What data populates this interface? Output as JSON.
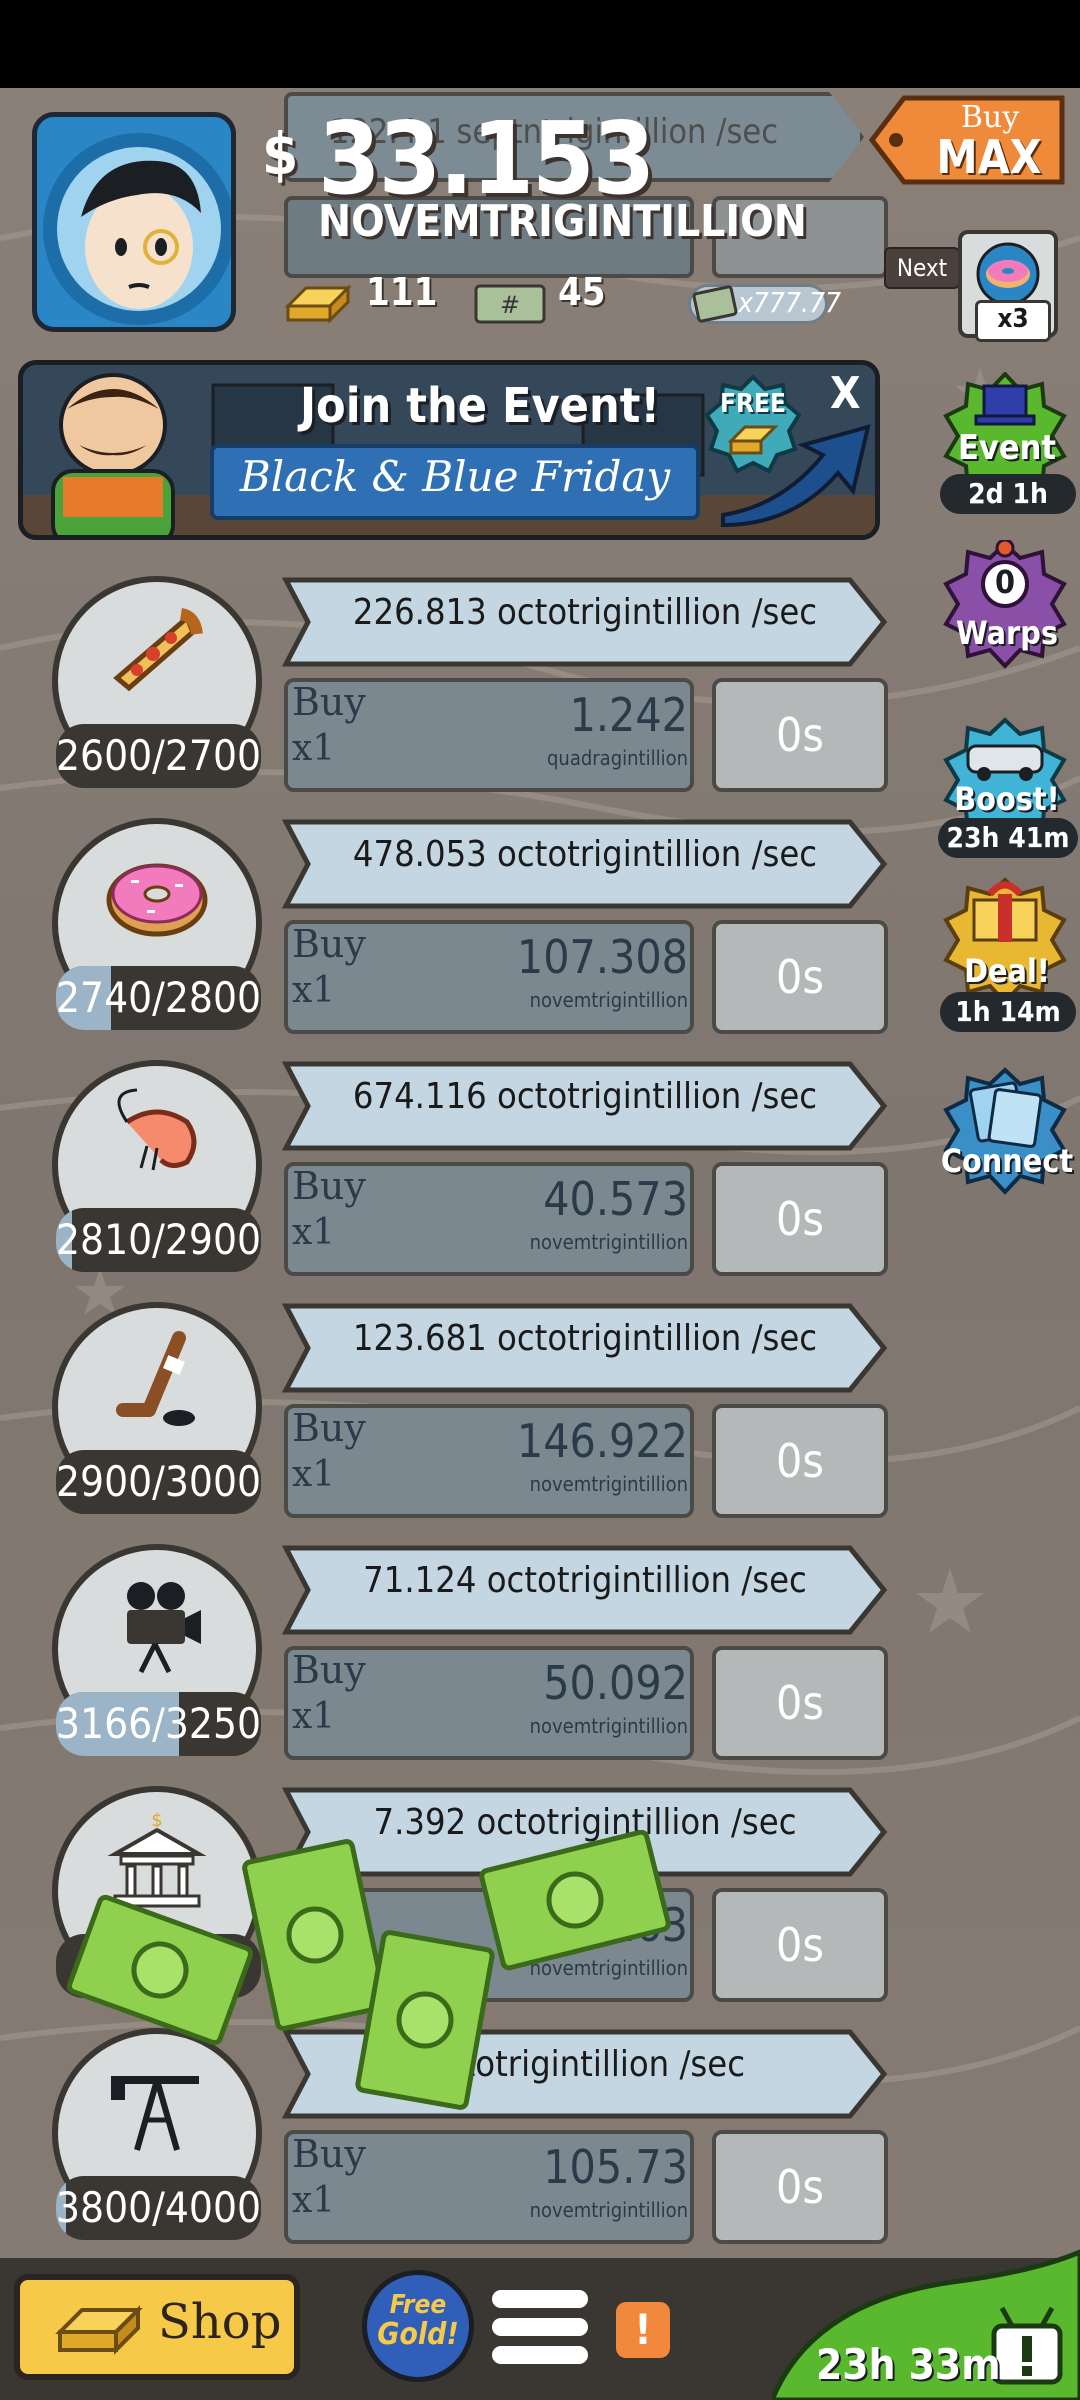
{
  "header": {
    "currency_symbol": "$",
    "money_amount": "33.153",
    "money_unit": "NOVEMTRIGINTILLION",
    "gold_count": "111",
    "megabucks_count": "45",
    "multiplier": "x777.77",
    "buy_max_top": "Buy",
    "buy_max_bottom": "MAX",
    "next_label": "Next",
    "next_multiplier": "x3",
    "partial_rate_behind": "122.4 1 septntrigintillion /sec"
  },
  "event_banner": {
    "title": "Join the Event!",
    "subtitle": "Black & Blue Friday",
    "free_label": "FREE",
    "close_label": "X"
  },
  "side_buttons": [
    {
      "name": "event",
      "label": "Event",
      "timer": "2d 1h",
      "color": "#5ab82f"
    },
    {
      "name": "warps",
      "label": "Warps",
      "badge": "0",
      "color": "#8a4fa6"
    },
    {
      "name": "boost",
      "label": "Boost!",
      "timer": "23h 41m",
      "color": "#3fb4d6"
    },
    {
      "name": "deal",
      "label": "Deal!",
      "timer": "1h 14m",
      "color": "#e8b833"
    },
    {
      "name": "connect",
      "label": "Connect",
      "color": "#3a8fc7"
    }
  ],
  "businesses": [
    {
      "icon": "pizza-icon",
      "count": "2600/2700",
      "progress": 0.0,
      "rate": "226.813 octotrigintillion /sec",
      "buy_label": "Buy",
      "buy_multiplier": "x1",
      "price": "1.242",
      "price_unit": "quadragintillion",
      "timer": "0s"
    },
    {
      "icon": "donut-icon",
      "count": "2740/2800",
      "progress": 0.27,
      "rate": "478.053 octotrigintillion /sec",
      "buy_label": "Buy",
      "buy_multiplier": "x1",
      "price": "107.308",
      "price_unit": "novemtrigintillion",
      "timer": "0s"
    },
    {
      "icon": "shrimp-icon",
      "count": "2810/2900",
      "progress": 0.08,
      "rate": "674.116 octotrigintillion /sec",
      "buy_label": "Buy",
      "buy_multiplier": "x1",
      "price": "40.573",
      "price_unit": "novemtrigintillion",
      "timer": "0s"
    },
    {
      "icon": "hockey-stick-icon",
      "count": "2900/3000",
      "progress": 0.0,
      "rate": "123.681 octotrigintillion /sec",
      "buy_label": "Buy",
      "buy_multiplier": "x1",
      "price": "146.922",
      "price_unit": "novemtrigintillion",
      "timer": "0s"
    },
    {
      "icon": "movie-camera-icon",
      "count": "3166/3250",
      "progress": 0.6,
      "rate": "71.124 octotrigintillion /sec",
      "buy_label": "Buy",
      "buy_multiplier": "x1",
      "price": "50.092",
      "price_unit": "novemtrigintillion",
      "timer": "0s"
    },
    {
      "icon": "bank-icon",
      "count": "3750",
      "progress": 0.0,
      "rate": "7.392 octotrigintillion /sec",
      "buy_label": "Buy",
      "buy_multiplier": "x1",
      "price": "163",
      "price_unit": "novemtrigintillion",
      "timer": "0s"
    },
    {
      "icon": "oil-rig-icon",
      "count": "3800/4000",
      "progress": 0.05,
      "rate": "octotrigintillion /sec",
      "buy_label": "Buy",
      "buy_multiplier": "x1",
      "price": "105.73",
      "price_unit": "novemtrigintillion",
      "timer": "0s"
    }
  ],
  "bottom_bar": {
    "shop_label": "Shop",
    "free_gold_top": "Free",
    "free_gold_bottom": "Gold!",
    "alert_label": "!",
    "tv_timer": "23h 33m"
  },
  "colors": {
    "rate_banner": "#c3d6e2",
    "buy_panel": "#7b8890",
    "timer_panel": "#b5b8b9",
    "gold": "#f7c948",
    "cash_green": "#8fd14f"
  }
}
